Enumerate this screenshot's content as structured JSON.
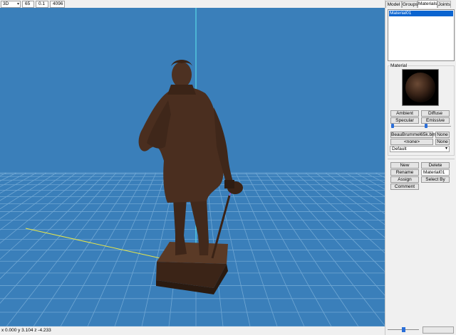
{
  "toolbar": {
    "view_mode": "3D",
    "fov": "65",
    "near_clip": "0.1",
    "far_clip": "4096"
  },
  "status": {
    "coords": "x 0.000 y 3.104 z -4.233"
  },
  "panel": {
    "tabs": [
      {
        "label": "Model"
      },
      {
        "label": "Groups"
      },
      {
        "label": "Materials"
      },
      {
        "label": "Joints"
      }
    ],
    "materials": [
      "Material01"
    ],
    "material_group_label": "Material",
    "color_buttons": {
      "ambient": "Ambient",
      "diffuse": "Diffuse",
      "specular": "Specular",
      "emissive": "Emissive"
    },
    "texture_file": "BeauBrummel65k.bmp",
    "texture_none": "None",
    "alpha_map": "<none>",
    "alpha_none": "None",
    "blend_mode": "Default",
    "actions": {
      "new": "New",
      "delete": "Delete",
      "rename": "Rename",
      "rename_value": "Material01",
      "assign": "Assign",
      "select_by": "Select By",
      "comment": "Comment"
    },
    "slider_level": 0.5
  },
  "colors": {
    "viewport_bg": "#3a7fba",
    "grid": "#7aaed8",
    "axis_x": "#e6e64a",
    "axis_y": "#5ee8f0",
    "axis_z": "#c24ad8",
    "statue": "#4a2e1f",
    "selection": "#0a64d0"
  }
}
